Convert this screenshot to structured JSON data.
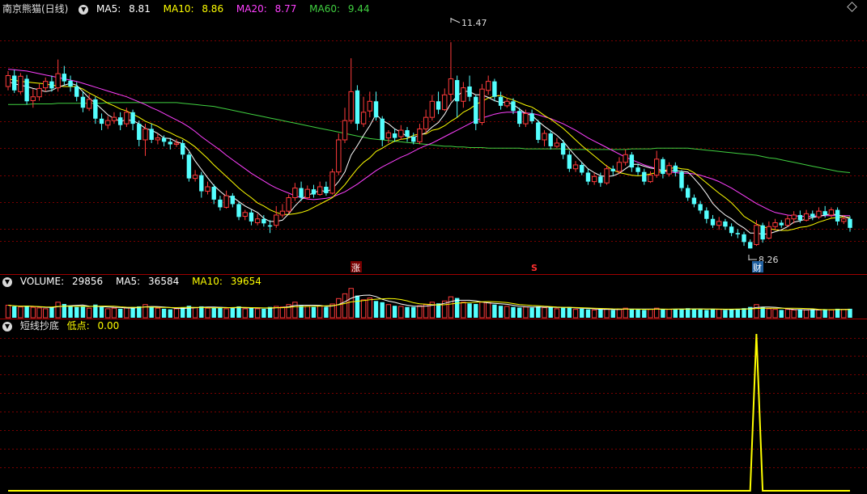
{
  "main": {
    "title": "南京熊猫(日线)",
    "ma5_label": "MA5:",
    "ma5_value": "8.81",
    "ma10_label": "MA10:",
    "ma10_value": "8.86",
    "ma20_label": "MA20:",
    "ma20_value": "8.77",
    "ma60_label": "MA60:",
    "ma60_value": "9.44",
    "high_label": "11.47",
    "low_label": "8.26",
    "marker_zhang": "涨",
    "marker_s": "S",
    "marker_cai": "财"
  },
  "volume_panel": {
    "vol_label": "VOLUME:",
    "vol_value": "29856",
    "ma5_label": "MA5:",
    "ma5_value": "36584",
    "ma10_label": "MA10:",
    "ma10_value": "39654"
  },
  "indicator_panel": {
    "name": "短线抄底",
    "low_label": "低点:",
    "low_value": "0.00"
  },
  "colors": {
    "up": "#ff3b3b",
    "down": "#54ffff",
    "ma5": "#ffffff",
    "ma10": "#ffff00",
    "ma20": "#ff40ff",
    "ma60": "#40d040",
    "grid": "#7a0000",
    "signal": "#ffff00"
  },
  "chart_data": {
    "type": "candlestick",
    "y_range_main": [
      8.1,
      11.9
    ],
    "candles": [
      [
        10.78,
        10.95,
        11.02,
        10.72
      ],
      [
        10.95,
        10.72,
        11.04,
        10.68
      ],
      [
        10.7,
        10.94,
        10.99,
        10.66
      ],
      [
        10.9,
        10.55,
        10.96,
        10.5
      ],
      [
        10.56,
        10.62,
        10.74,
        10.45
      ],
      [
        10.62,
        10.75,
        10.82,
        10.56
      ],
      [
        10.76,
        10.86,
        10.92,
        10.7
      ],
      [
        10.86,
        10.75,
        10.95,
        10.7
      ],
      [
        10.76,
        10.98,
        11.2,
        10.7
      ],
      [
        10.98,
        10.86,
        11.1,
        10.8
      ],
      [
        10.87,
        10.78,
        10.95,
        10.7
      ],
      [
        10.78,
        10.62,
        10.85,
        10.55
      ],
      [
        10.62,
        10.45,
        10.7,
        10.38
      ],
      [
        10.44,
        10.58,
        10.66,
        10.4
      ],
      [
        10.58,
        10.28,
        10.62,
        10.2
      ],
      [
        10.28,
        10.2,
        10.36,
        10.1
      ],
      [
        10.18,
        10.25,
        10.32,
        10.12
      ],
      [
        10.25,
        10.3,
        10.38,
        10.2
      ],
      [
        10.3,
        10.18,
        10.38,
        10.1
      ],
      [
        10.2,
        10.38,
        10.45,
        10.15
      ],
      [
        10.38,
        10.2,
        10.42,
        10.1
      ],
      [
        10.2,
        9.95,
        10.25,
        9.85
      ],
      [
        9.95,
        10.12,
        10.2,
        9.7
      ],
      [
        10.12,
        9.95,
        10.2,
        9.9
      ],
      [
        9.95,
        9.98,
        10.05,
        9.88
      ],
      [
        9.98,
        9.92,
        10.02,
        9.85
      ],
      [
        9.92,
        9.88,
        9.98,
        9.8
      ],
      [
        9.88,
        9.9,
        9.96,
        9.84
      ],
      [
        9.9,
        9.72,
        9.95,
        9.65
      ],
      [
        9.72,
        9.35,
        9.76,
        9.3
      ],
      [
        9.35,
        9.4,
        9.48,
        9.3
      ],
      [
        9.4,
        9.15,
        9.45,
        9.05
      ],
      [
        9.15,
        9.22,
        9.3,
        9.1
      ],
      [
        9.22,
        9.02,
        9.26,
        8.95
      ],
      [
        9.02,
        8.9,
        9.08,
        8.85
      ],
      [
        8.9,
        9.08,
        9.16,
        8.88
      ],
      [
        9.08,
        8.95,
        9.12,
        8.9
      ],
      [
        8.95,
        8.75,
        8.98,
        8.7
      ],
      [
        8.76,
        8.82,
        8.86,
        8.7
      ],
      [
        8.82,
        8.68,
        8.86,
        8.62
      ],
      [
        8.66,
        8.72,
        8.8,
        8.62
      ],
      [
        8.72,
        8.65,
        8.78,
        8.6
      ],
      [
        8.62,
        8.6,
        8.7,
        8.5
      ],
      [
        8.62,
        8.78,
        8.92,
        8.58
      ],
      [
        8.78,
        8.84,
        8.95,
        8.74
      ],
      [
        8.84,
        9.05,
        9.1,
        8.8
      ],
      [
        9.05,
        9.2,
        9.28,
        9.0
      ],
      [
        9.2,
        9.05,
        9.3,
        9.0
      ],
      [
        9.05,
        9.18,
        9.24,
        9.02
      ],
      [
        9.18,
        9.1,
        9.25,
        9.05
      ],
      [
        9.1,
        9.22,
        9.3,
        9.08
      ],
      [
        9.22,
        9.12,
        9.3,
        9.08
      ],
      [
        9.12,
        9.45,
        9.5,
        9.1
      ],
      [
        9.45,
        9.95,
        10.05,
        9.4
      ],
      [
        9.95,
        10.25,
        10.45,
        9.9
      ],
      [
        10.25,
        10.7,
        11.22,
        10.2
      ],
      [
        10.72,
        10.2,
        10.8,
        10.1
      ],
      [
        10.2,
        10.38,
        10.62,
        10.15
      ],
      [
        10.4,
        10.55,
        10.7,
        10.3
      ],
      [
        10.55,
        10.3,
        10.7,
        10.25
      ],
      [
        10.28,
        9.95,
        10.32,
        9.85
      ],
      [
        9.98,
        10.06,
        10.1,
        9.9
      ],
      [
        10.05,
        9.98,
        10.12,
        9.92
      ],
      [
        10.0,
        10.1,
        10.18,
        9.95
      ],
      [
        10.1,
        10.0,
        10.15,
        9.92
      ],
      [
        10.0,
        9.92,
        10.06,
        9.88
      ],
      [
        9.92,
        10.12,
        10.2,
        9.88
      ],
      [
        10.12,
        10.3,
        10.42,
        10.05
      ],
      [
        10.3,
        10.55,
        10.65,
        10.25
      ],
      [
        10.55,
        10.42,
        10.7,
        10.35
      ],
      [
        10.42,
        10.65,
        10.75,
        10.4
      ],
      [
        10.66,
        10.9,
        11.47,
        10.55
      ],
      [
        10.88,
        10.55,
        10.95,
        10.3
      ],
      [
        10.55,
        10.76,
        10.85,
        10.45
      ],
      [
        10.78,
        10.62,
        10.95,
        10.55
      ],
      [
        10.62,
        10.2,
        10.65,
        10.1
      ],
      [
        10.22,
        10.74,
        10.82,
        10.18
      ],
      [
        10.72,
        10.86,
        10.95,
        10.65
      ],
      [
        10.86,
        10.62,
        10.9,
        10.55
      ],
      [
        10.62,
        10.48,
        10.7,
        10.42
      ],
      [
        10.48,
        10.55,
        10.6,
        10.45
      ],
      [
        10.55,
        10.4,
        10.6,
        10.35
      ],
      [
        10.4,
        10.2,
        10.45,
        10.15
      ],
      [
        10.2,
        10.36,
        10.42,
        10.15
      ],
      [
        10.36,
        10.24,
        10.42,
        10.2
      ],
      [
        10.22,
        9.95,
        10.26,
        9.9
      ],
      [
        9.95,
        10.05,
        10.1,
        9.85
      ],
      [
        10.05,
        9.85,
        10.1,
        9.8
      ],
      [
        9.85,
        9.9,
        9.98,
        9.82
      ],
      [
        9.9,
        9.72,
        9.95,
        9.65
      ],
      [
        9.72,
        9.5,
        9.78,
        9.45
      ],
      [
        9.5,
        9.56,
        9.62,
        9.45
      ],
      [
        9.56,
        9.44,
        9.6,
        9.4
      ],
      [
        9.44,
        9.3,
        9.5,
        9.25
      ],
      [
        9.3,
        9.38,
        9.44,
        9.25
      ],
      [
        9.38,
        9.28,
        9.44,
        9.22
      ],
      [
        9.28,
        9.5,
        9.56,
        9.25
      ],
      [
        9.5,
        9.46,
        9.55,
        9.4
      ],
      [
        9.46,
        9.6,
        9.68,
        9.42
      ],
      [
        9.6,
        9.72,
        9.8,
        9.55
      ],
      [
        9.72,
        9.52,
        9.76,
        9.45
      ],
      [
        9.52,
        9.45,
        9.58,
        9.4
      ],
      [
        9.45,
        9.3,
        9.5,
        9.25
      ],
      [
        9.3,
        9.4,
        9.46,
        9.28
      ],
      [
        9.4,
        9.65,
        9.78,
        9.36
      ],
      [
        9.65,
        9.42,
        9.68,
        9.35
      ],
      [
        9.42,
        9.55,
        9.6,
        9.38
      ],
      [
        9.55,
        9.45,
        9.6,
        9.38
      ],
      [
        9.45,
        9.2,
        9.48,
        9.15
      ],
      [
        9.2,
        9.05,
        9.25,
        9.0
      ],
      [
        9.05,
        8.95,
        9.1,
        8.9
      ],
      [
        8.95,
        8.85,
        9.0,
        8.8
      ],
      [
        8.85,
        8.72,
        8.9,
        8.65
      ],
      [
        8.72,
        8.62,
        8.78,
        8.58
      ],
      [
        8.62,
        8.68,
        8.75,
        8.55
      ],
      [
        8.68,
        8.6,
        8.72,
        8.55
      ],
      [
        8.6,
        8.5,
        8.65,
        8.45
      ],
      [
        8.5,
        8.48,
        8.56,
        8.42
      ],
      [
        8.48,
        8.36,
        8.52,
        8.3
      ],
      [
        8.36,
        8.26,
        8.4,
        8.26
      ],
      [
        8.32,
        8.62,
        8.7,
        8.3
      ],
      [
        8.62,
        8.4,
        8.66,
        8.35
      ],
      [
        8.42,
        8.6,
        8.68,
        8.4
      ],
      [
        8.6,
        8.66,
        8.72,
        8.55
      ],
      [
        8.66,
        8.62,
        8.7,
        8.58
      ],
      [
        8.62,
        8.72,
        8.78,
        8.6
      ],
      [
        8.72,
        8.78,
        8.84,
        8.65
      ],
      [
        8.78,
        8.7,
        8.85,
        8.66
      ],
      [
        8.7,
        8.8,
        8.86,
        8.68
      ],
      [
        8.8,
        8.75,
        8.85,
        8.7
      ],
      [
        8.75,
        8.84,
        8.9,
        8.72
      ],
      [
        8.84,
        8.78,
        8.92,
        8.74
      ],
      [
        8.78,
        8.86,
        8.9,
        8.74
      ],
      [
        8.86,
        8.68,
        8.9,
        8.62
      ],
      [
        8.68,
        8.72,
        8.78,
        8.64
      ],
      [
        8.72,
        8.58,
        8.76,
        8.52
      ]
    ],
    "ma5": [
      10.86,
      10.82,
      10.8,
      10.78,
      10.75,
      10.73,
      10.7,
      10.72,
      10.77,
      10.8,
      10.83,
      10.8,
      10.7,
      10.6,
      10.52,
      10.43,
      10.34,
      10.28,
      10.24,
      10.26,
      10.25,
      10.2,
      10.13,
      10.1,
      10.05,
      9.98,
      9.97,
      9.92,
      9.89,
      9.78,
      9.62,
      9.49,
      9.36,
      9.24,
      9.15,
      9.07,
      9.06,
      8.99,
      8.92,
      8.87,
      8.82,
      8.73,
      8.68,
      8.68,
      8.7,
      8.8,
      8.92,
      9.02,
      9.09,
      9.12,
      9.17,
      9.14,
      9.19,
      9.3,
      9.45,
      9.71,
      9.86,
      10.02,
      10.17,
      10.35,
      10.25,
      10.2,
      10.12,
      10.07,
      10.0,
      9.99,
      10.02,
      10.06,
      10.15,
      10.22,
      10.35,
      10.52,
      10.63,
      10.71,
      10.7,
      10.65,
      10.65,
      10.61,
      10.56,
      10.53,
      10.54,
      10.5,
      10.43,
      10.36,
      10.33,
      10.24,
      10.16,
      10.09,
      10.02,
      9.93,
      9.81,
      9.7,
      9.6,
      9.5,
      9.44,
      9.39,
      9.38,
      9.39,
      9.43,
      9.5,
      9.57,
      9.57,
      9.54,
      9.51,
      9.5,
      9.46,
      9.47,
      9.47,
      9.46,
      9.45,
      9.35,
      9.24,
      9.11,
      8.96,
      8.86,
      8.78,
      8.72,
      8.64,
      8.58,
      8.5,
      8.5,
      8.48,
      8.49,
      8.52,
      8.55,
      8.6,
      8.67,
      8.69,
      8.72,
      8.74,
      8.76,
      8.78,
      8.8,
      8.78,
      8.76,
      8.72
    ],
    "ma10": [
      10.9,
      10.88,
      10.86,
      10.85,
      10.84,
      10.83,
      10.82,
      10.8,
      10.79,
      10.78,
      10.78,
      10.78,
      10.74,
      10.68,
      10.63,
      10.58,
      10.52,
      10.48,
      10.43,
      10.4,
      10.35,
      10.3,
      10.24,
      10.2,
      10.16,
      10.1,
      10.06,
      10.01,
      9.97,
      9.91,
      9.84,
      9.75,
      9.66,
      9.56,
      9.47,
      9.38,
      9.29,
      9.2,
      9.12,
      9.05,
      8.97,
      8.92,
      8.86,
      8.82,
      8.79,
      8.79,
      8.8,
      8.82,
      8.85,
      8.9,
      8.95,
      9.0,
      9.05,
      9.15,
      9.25,
      9.38,
      9.5,
      9.6,
      9.67,
      9.77,
      9.82,
      9.88,
      9.93,
      9.96,
      9.97,
      10.02,
      10.04,
      10.04,
      10.1,
      10.12,
      10.17,
      10.24,
      10.3,
      10.38,
      10.43,
      10.5,
      10.55,
      10.6,
      10.63,
      10.64,
      10.6,
      10.57,
      10.53,
      10.49,
      10.46,
      10.4,
      10.33,
      10.27,
      10.2,
      10.13,
      10.04,
      9.95,
      9.86,
      9.78,
      9.7,
      9.62,
      9.54,
      9.48,
      9.44,
      9.42,
      9.4,
      9.39,
      9.4,
      9.42,
      9.44,
      9.46,
      9.5,
      9.52,
      9.5,
      9.49,
      9.44,
      9.36,
      9.28,
      9.2,
      9.12,
      9.05,
      8.97,
      8.87,
      8.76,
      8.7,
      8.64,
      8.6,
      8.57,
      8.55,
      8.54,
      8.54,
      8.56,
      8.59,
      8.6,
      8.63,
      8.67,
      8.7,
      8.73,
      8.74,
      8.75,
      8.74
    ],
    "ma20": [
      11.05,
      11.04,
      11.03,
      11.02,
      11.0,
      10.98,
      10.96,
      10.94,
      10.92,
      10.9,
      10.88,
      10.86,
      10.83,
      10.8,
      10.77,
      10.74,
      10.71,
      10.68,
      10.65,
      10.62,
      10.58,
      10.54,
      10.5,
      10.45,
      10.41,
      10.36,
      10.31,
      10.26,
      10.21,
      10.15,
      10.08,
      10.0,
      9.93,
      9.86,
      9.79,
      9.71,
      9.64,
      9.57,
      9.5,
      9.43,
      9.37,
      9.31,
      9.25,
      9.2,
      9.16,
      9.12,
      9.08,
      9.05,
      9.03,
      9.02,
      9.03,
      9.04,
      9.06,
      9.1,
      9.14,
      9.2,
      9.26,
      9.33,
      9.4,
      9.47,
      9.53,
      9.58,
      9.63,
      9.68,
      9.72,
      9.77,
      9.82,
      9.86,
      9.9,
      9.95,
      10.0,
      10.05,
      10.1,
      10.15,
      10.2,
      10.25,
      10.29,
      10.32,
      10.35,
      10.37,
      10.38,
      10.38,
      10.38,
      10.37,
      10.36,
      10.34,
      10.31,
      10.28,
      10.24,
      10.2,
      10.15,
      10.1,
      10.04,
      9.98,
      9.93,
      9.88,
      9.83,
      9.78,
      9.73,
      9.68,
      9.64,
      9.6,
      9.56,
      9.53,
      9.5,
      9.47,
      9.45,
      9.44,
      9.43,
      9.43,
      9.42,
      9.4,
      9.37,
      9.34,
      9.3,
      9.25,
      9.2,
      9.14,
      9.08,
      9.02,
      8.96,
      8.91,
      8.86,
      8.82,
      8.8,
      8.78,
      8.77,
      8.76,
      8.76,
      8.76,
      8.77,
      8.77,
      8.77,
      8.77,
      8.77,
      8.77
    ],
    "ma60": [
      10.5,
      10.5,
      10.5,
      10.5,
      10.51,
      10.51,
      10.51,
      10.51,
      10.52,
      10.52,
      10.52,
      10.52,
      10.52,
      10.52,
      10.52,
      10.52,
      10.53,
      10.53,
      10.53,
      10.53,
      10.53,
      10.53,
      10.53,
      10.53,
      10.53,
      10.53,
      10.53,
      10.53,
      10.52,
      10.51,
      10.5,
      10.49,
      10.48,
      10.47,
      10.45,
      10.43,
      10.41,
      10.39,
      10.37,
      10.35,
      10.33,
      10.31,
      10.29,
      10.27,
      10.25,
      10.23,
      10.21,
      10.19,
      10.17,
      10.15,
      10.13,
      10.11,
      10.09,
      10.07,
      10.05,
      10.03,
      10.01,
      9.99,
      9.97,
      9.96,
      9.95,
      9.94,
      9.93,
      9.92,
      9.91,
      9.9,
      9.89,
      9.88,
      9.87,
      9.86,
      9.85,
      9.85,
      9.84,
      9.84,
      9.83,
      9.83,
      9.83,
      9.82,
      9.82,
      9.82,
      9.82,
      9.82,
      9.82,
      9.81,
      9.81,
      9.81,
      9.81,
      9.81,
      9.81,
      9.81,
      9.8,
      9.8,
      9.8,
      9.8,
      9.8,
      9.8,
      9.8,
      9.8,
      9.8,
      9.8,
      9.81,
      9.81,
      9.81,
      9.81,
      9.82,
      9.82,
      9.82,
      9.82,
      9.82,
      9.82,
      9.81,
      9.8,
      9.79,
      9.78,
      9.77,
      9.76,
      9.75,
      9.74,
      9.73,
      9.72,
      9.71,
      9.69,
      9.67,
      9.66,
      9.64,
      9.62,
      9.6,
      9.58,
      9.56,
      9.54,
      9.52,
      9.5,
      9.48,
      9.46,
      9.45,
      9.44
    ],
    "volume": [
      42,
      38,
      36,
      40,
      35,
      33,
      30,
      34,
      52,
      46,
      40,
      36,
      38,
      32,
      44,
      36,
      30,
      32,
      30,
      34,
      36,
      38,
      44,
      36,
      32,
      30,
      28,
      30,
      34,
      40,
      34,
      38,
      32,
      34,
      36,
      30,
      32,
      38,
      30,
      34,
      30,
      30,
      36,
      38,
      36,
      44,
      52,
      40,
      38,
      36,
      40,
      36,
      46,
      64,
      80,
      98,
      74,
      60,
      66,
      56,
      52,
      44,
      40,
      38,
      36,
      36,
      40,
      44,
      52,
      48,
      56,
      70,
      66,
      52,
      48,
      46,
      52,
      50,
      44,
      40,
      38,
      36,
      34,
      36,
      34,
      38,
      34,
      36,
      30,
      34,
      36,
      28,
      30,
      28,
      26,
      28,
      30,
      26,
      28,
      32,
      30,
      28,
      26,
      28,
      32,
      28,
      28,
      28,
      30,
      32,
      30,
      28,
      26,
      30,
      28,
      26,
      28,
      30,
      32,
      36,
      44,
      36,
      30,
      28,
      26,
      28,
      26,
      28,
      26,
      28,
      26,
      28,
      26,
      30,
      28,
      30
    ],
    "signal_index": 120,
    "y_label": "",
    "x_label": ""
  }
}
